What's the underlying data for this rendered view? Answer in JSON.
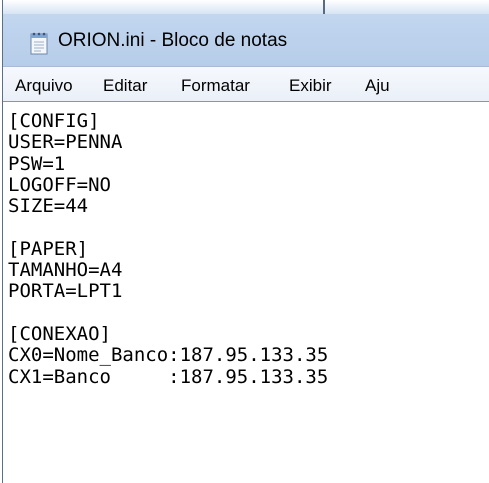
{
  "window": {
    "title": "ORION.ini - Bloco de notas",
    "icon": "notepad-icon"
  },
  "menu": {
    "items": [
      "Arquivo",
      "Editar",
      "Formatar",
      "Exibir",
      "Aju"
    ]
  },
  "editor": {
    "content": "[CONFIG]\nUSER=PENNA\nPSW=1\nLOGOFF=NO\nSIZE=44\n\n[PAPER]\nTAMANHO=A4\nPORTA=LPT1\n\n[CONEXAO]\nCX0=Nome_Banco:187.95.133.35\nCX1=Banco     :187.95.133.35"
  },
  "colors": {
    "titlebar": "#bfd4ee",
    "menubar": "#eef3f9",
    "editor_bg": "#ffffff",
    "text": "#000000"
  }
}
